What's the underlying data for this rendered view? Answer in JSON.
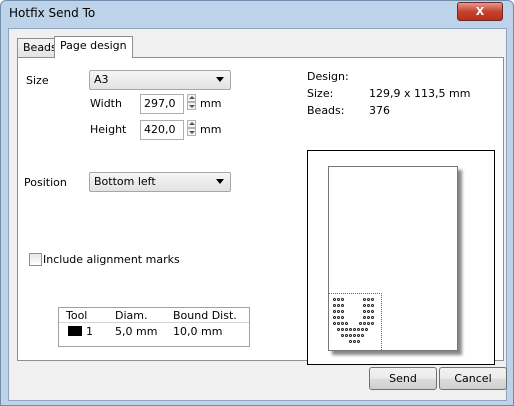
{
  "window": {
    "title": "Hotfix Send To",
    "close_label": "X"
  },
  "tabs": [
    {
      "label": "Beads"
    },
    {
      "label": "Page design",
      "active": true
    }
  ],
  "size": {
    "label": "Size",
    "selected": "A3"
  },
  "width": {
    "label": "Width",
    "value": "297,0",
    "unit": "mm"
  },
  "height": {
    "label": "Height",
    "value": "420,0",
    "unit": "mm"
  },
  "position": {
    "label": "Position",
    "selected": "Bottom left"
  },
  "alignment": {
    "label": "Include alignment marks",
    "checked": false
  },
  "tool_table": {
    "headers": [
      "Tool",
      "Diam.",
      "Bound Dist."
    ],
    "rows": [
      {
        "tool": "1",
        "color": "#000000",
        "diam": "5,0 mm",
        "bound_dist": "10,0 mm"
      }
    ]
  },
  "design": {
    "label": "Design:",
    "size_label": "Size:",
    "size_value": "129,9 x 113,5 mm",
    "beads_label": "Beads:",
    "beads_value": "376"
  },
  "buttons": {
    "send": "Send",
    "cancel": "Cancel"
  }
}
